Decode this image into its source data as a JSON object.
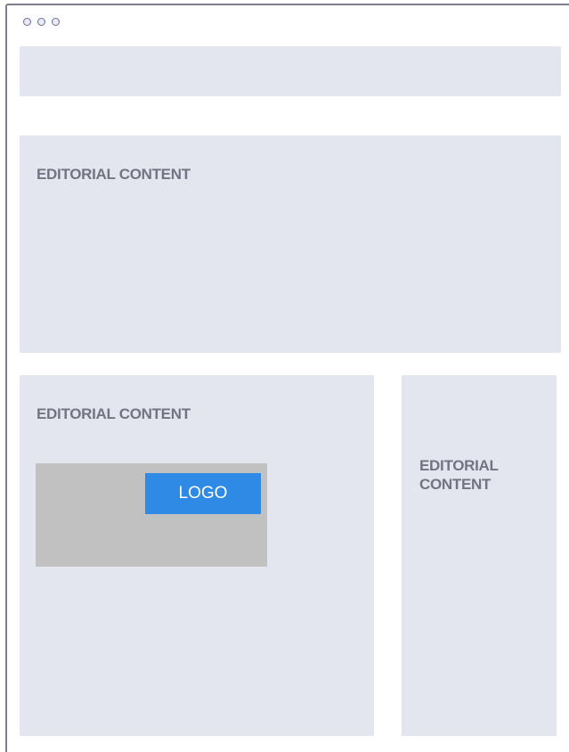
{
  "window": {
    "controls": [
      "close",
      "minimize",
      "maximize"
    ]
  },
  "header": {
    "placeholder": ""
  },
  "hero": {
    "label": "EDITORIAL CONTENT"
  },
  "main": {
    "label": "EDITORIAL CONTENT",
    "ad": {
      "logo_label": "LOGO"
    }
  },
  "sidebar": {
    "label": "EDITORIAL CONTENT"
  },
  "colors": {
    "frame": "#7b7f8c",
    "placeholder_block": "#e3e6ee",
    "ad_box": "#c1c1c1",
    "logo_button": "#2f8ae5",
    "label_text": "#727483"
  }
}
